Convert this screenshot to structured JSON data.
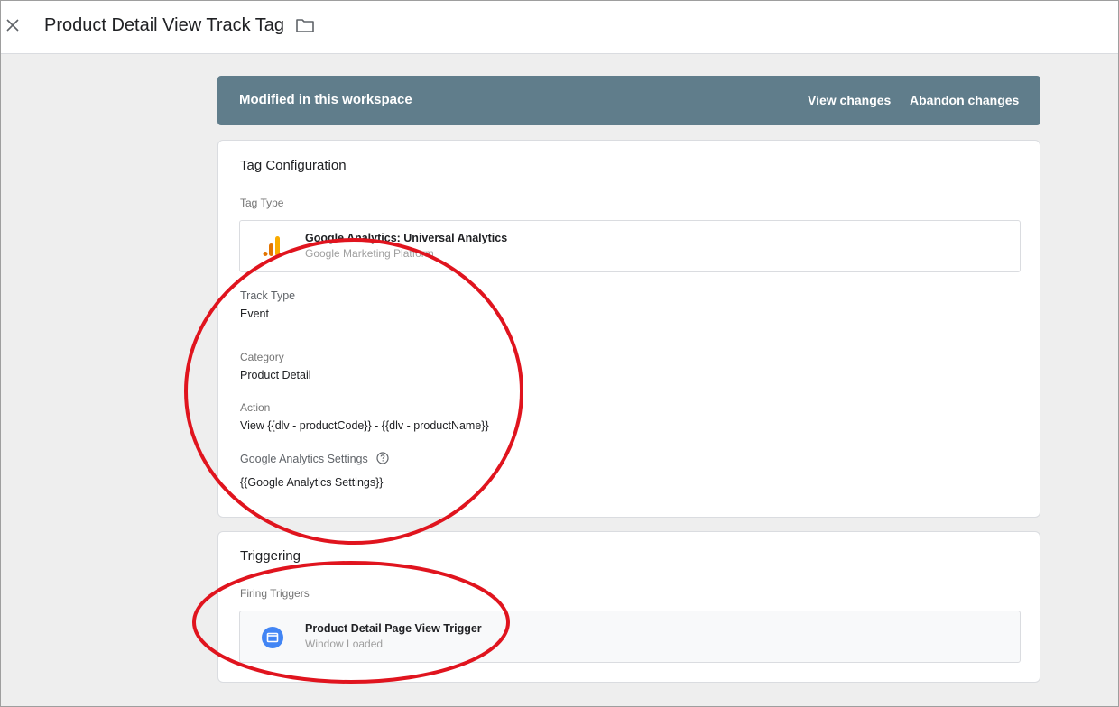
{
  "header": {
    "title": "Product Detail View Track Tag",
    "close_icon": "close-icon",
    "folder_icon": "folder-icon"
  },
  "banner": {
    "text": "Modified in this workspace",
    "view_changes": "View changes",
    "abandon_changes": "Abandon changes",
    "color": "#607d8b"
  },
  "tag_config": {
    "title": "Tag Configuration",
    "tag_type_label": "Tag Type",
    "tag_type": {
      "name": "Google Analytics: Universal Analytics",
      "provider": "Google Marketing Platform",
      "icon": "google-analytics-icon"
    },
    "fields": [
      {
        "label": "Track Type",
        "value": "Event"
      },
      {
        "label": "Category",
        "value": "Product Detail"
      },
      {
        "label": "Action",
        "value": "View {{dlv - productCode}} - {{dlv - productName}}"
      },
      {
        "label": "Google Analytics Settings",
        "value": "{{Google Analytics Settings}}"
      }
    ]
  },
  "triggering": {
    "title": "Triggering",
    "firing_label": "Firing Triggers",
    "trigger": {
      "name": "Product Detail Page View Trigger",
      "type": "Window Loaded",
      "icon": "window-loaded-icon",
      "color": "#4285f4"
    }
  },
  "colors": {
    "annotation_red": "#e0141e",
    "analytics_orange": "#f9ab00",
    "analytics_dark_orange": "#e37400"
  }
}
